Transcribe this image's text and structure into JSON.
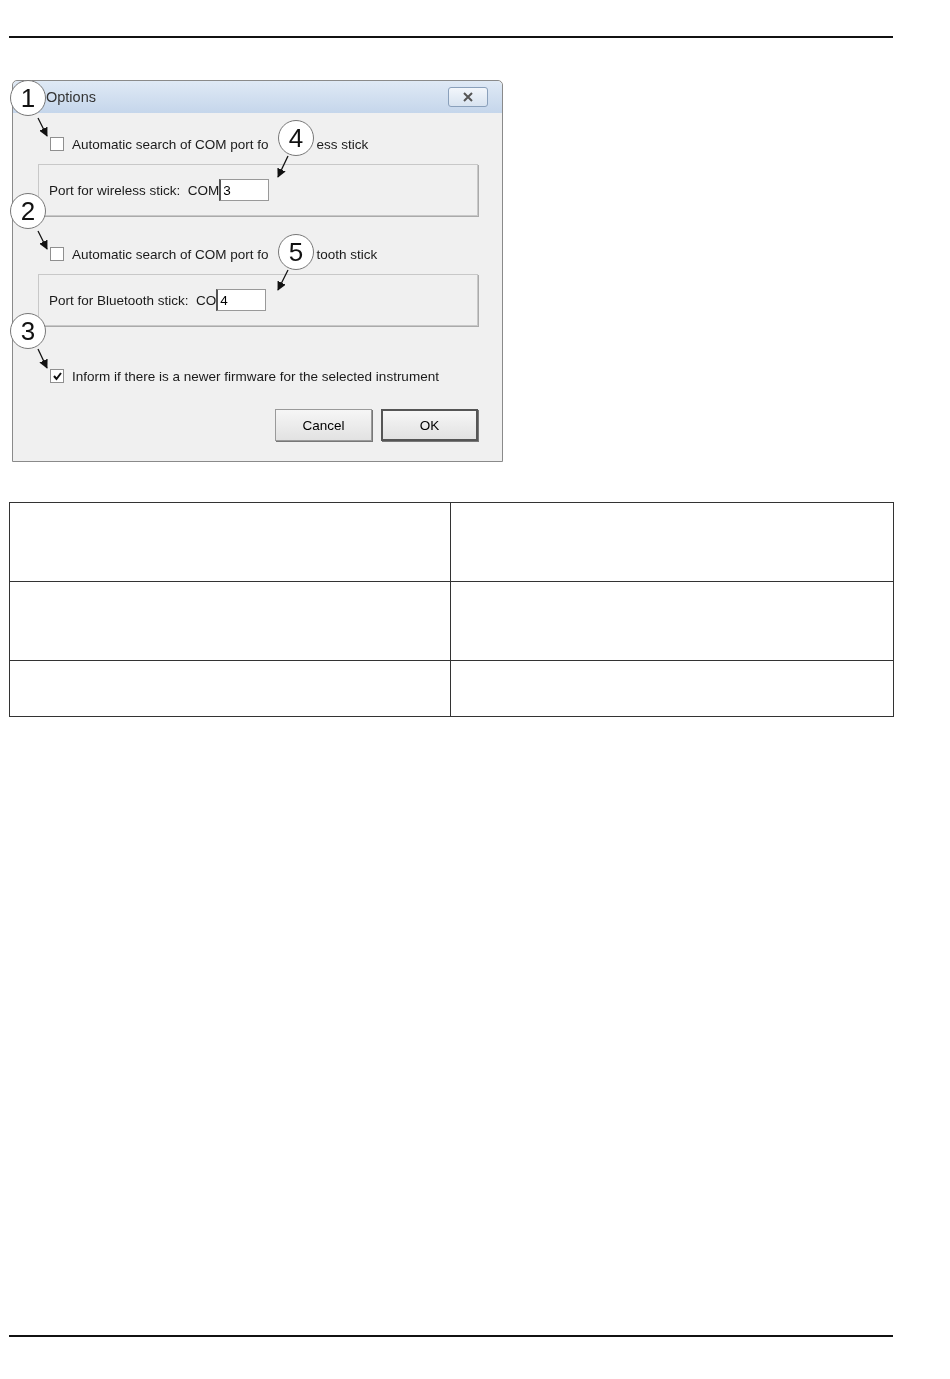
{
  "dialog": {
    "title": "Options",
    "rows": [
      {
        "kind": "checkbox",
        "checked": false,
        "label_parts": [
          "Automatic search of COM port fo",
          "ess stick"
        ],
        "callout": "1"
      },
      {
        "kind": "port",
        "label": "Port for wireless stick:  COM",
        "value": "3",
        "callout": "4"
      },
      {
        "kind": "checkbox",
        "checked": false,
        "label_parts": [
          "Automatic search of COM port fo",
          "tooth stick"
        ],
        "callout": "2"
      },
      {
        "kind": "port",
        "label": "Port for Bluetooth stick:  CO",
        "value": "4",
        "callout": "5"
      },
      {
        "kind": "checkbox",
        "checked": true,
        "label_parts": [
          "Inform if there is a newer firmware for the selected instrument"
        ],
        "callout": "3"
      }
    ],
    "buttons": [
      {
        "label": "Cancel",
        "default": false
      },
      {
        "label": "OK",
        "default": true
      }
    ]
  }
}
